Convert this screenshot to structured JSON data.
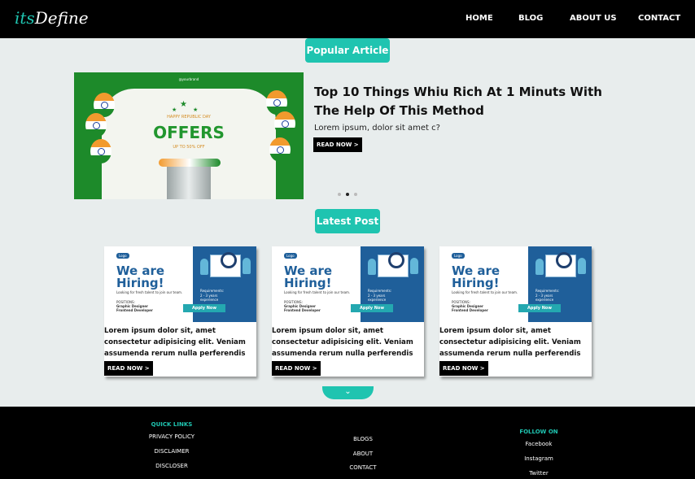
{
  "header": {
    "logo_a": "its",
    "logo_b": "Define",
    "nav": [
      "HOME",
      "BLOG",
      "ABOUT US",
      "CONTACT"
    ]
  },
  "popular": {
    "label": "Popular Article",
    "image": {
      "handle": "@yourbrand",
      "happy": "HAPPY REPUBLIC DAY",
      "offers": "OFFERS",
      "upto": "UP TO 50% OFF"
    },
    "title": "Top 10 Things Whiu Rich At 1 Minuts With The Help Of This Method",
    "desc": "Lorem ipsum, dolor sit amet c?",
    "read_more": "READ NOW >",
    "slider": {
      "count": 3,
      "active": 2
    }
  },
  "latest": {
    "label": "Latest Post",
    "cards": [
      {
        "image": {
          "logo": "Logo",
          "hire1": "We are",
          "hire2": "Hiring!",
          "looking": "Looking for fresh talent to join our team.",
          "positions": "POSITIONS:",
          "pos1": "Graphic Designer",
          "pos2": "Frontend Developer",
          "req": "Requirements:",
          "req2": "2 - 3 years experience",
          "apply": "Apply Now"
        },
        "text": "Lorem ipsum dolor sit, amet consectetur adipisicing elit. Veniam assumenda rerum nulla perferendis",
        "read_more": "READ NOW >"
      },
      {
        "image": {
          "logo": "Logo",
          "hire1": "We are",
          "hire2": "Hiring!",
          "looking": "Looking for fresh talent to join our team.",
          "positions": "POSITIONS:",
          "pos1": "Graphic Designer",
          "pos2": "Frontend Developer",
          "req": "Requirements:",
          "req2": "2 - 3 years experience",
          "apply": "Apply Now"
        },
        "text": "Lorem ipsum dolor sit, amet consectetur adipisicing elit. Veniam assumenda rerum nulla perferendis",
        "read_more": "READ NOW >"
      },
      {
        "image": {
          "logo": "Logo",
          "hire1": "We are",
          "hire2": "Hiring!",
          "looking": "Looking for fresh talent to join our team.",
          "positions": "POSITIONS:",
          "pos1": "Graphic Designer",
          "pos2": "Frontend Developer",
          "req": "Requirements:",
          "req2": "2 - 3 years experience",
          "apply": "Apply Now"
        },
        "text": "Lorem ipsum dolor sit, amet consectetur adipisicing elit. Veniam assumenda rerum nulla perferendis",
        "read_more": "READ NOW >"
      }
    ],
    "more_icon": "chevron-down-icon"
  },
  "footer": {
    "quick_links": {
      "heading": "QUICK LINKS",
      "items": [
        "PRIVACY POLICY",
        "DISCLAIMER",
        "DISCLOSER"
      ]
    },
    "middle": {
      "items": [
        "BLOGS",
        "ABOUT",
        "CONTACT"
      ]
    },
    "follow": {
      "heading": "FOLLOW ON",
      "items": [
        "Facebook",
        "Instagram",
        "Twitter"
      ]
    }
  },
  "colors": {
    "accent": "#1fc4b0",
    "header_bg": "#000000",
    "page_bg": "#e8eded",
    "card_blue": "#1f5f9a"
  }
}
